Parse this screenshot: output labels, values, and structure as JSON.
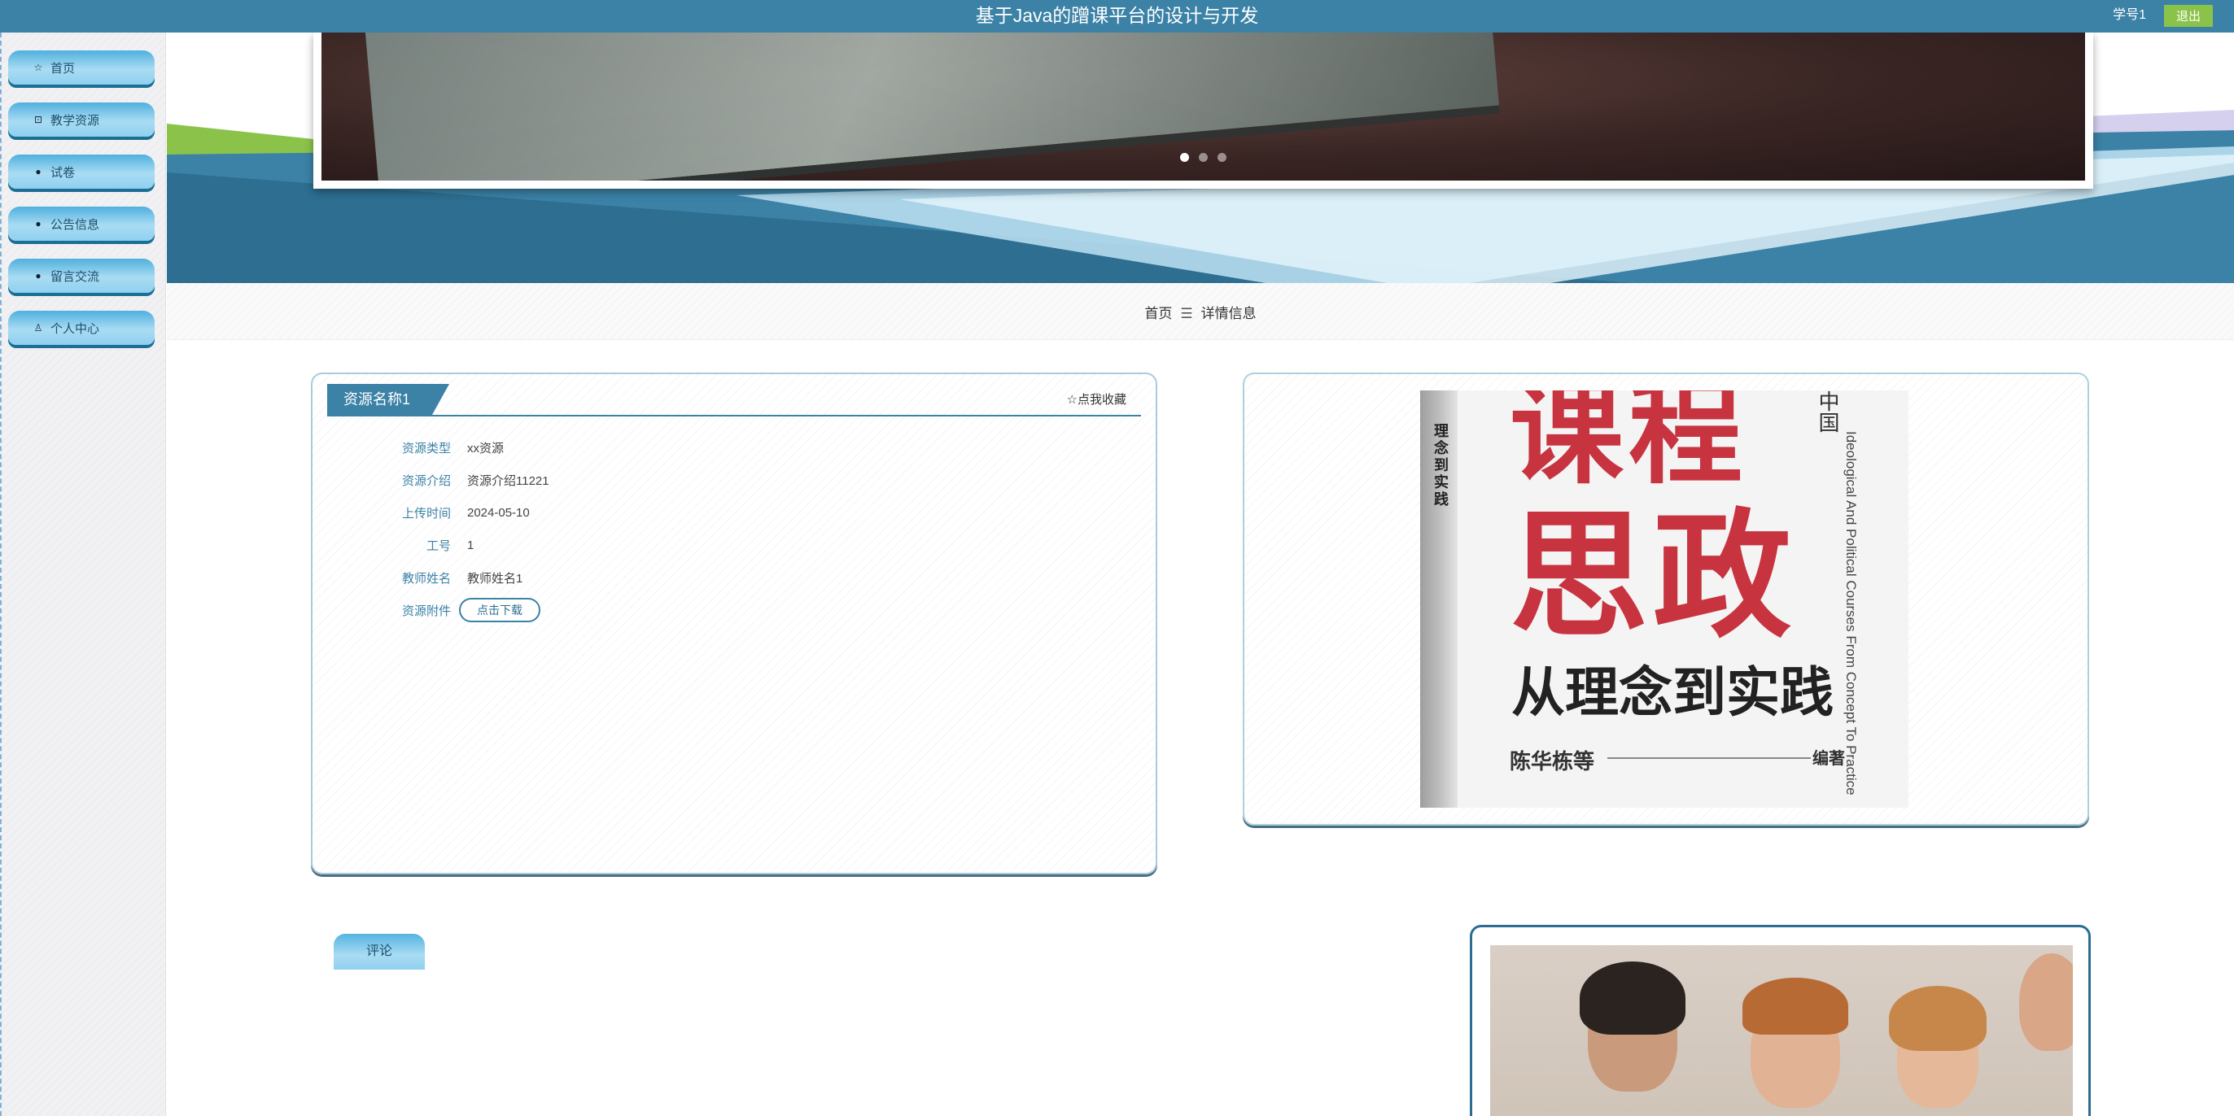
{
  "header": {
    "title": "基于Java的蹭课平台的设计与开发",
    "user": "学号1",
    "logout_label": "退出"
  },
  "sidebar": {
    "items": [
      {
        "label": "首页",
        "icon": "star-icon"
      },
      {
        "label": "教学资源",
        "icon": "bag-icon"
      },
      {
        "label": "试卷",
        "icon": "info-icon"
      },
      {
        "label": "公告信息",
        "icon": "question-icon"
      },
      {
        "label": "留言交流",
        "icon": "info-icon"
      },
      {
        "label": "个人中心",
        "icon": "user-icon"
      }
    ]
  },
  "carousel": {
    "slide_count": 3,
    "active_index": 0
  },
  "breadcrumb": {
    "home": "首页",
    "separator": "☰",
    "current": "详情信息"
  },
  "detail": {
    "name": "资源名称1",
    "favorite_label": "☆点我收藏",
    "fields": [
      {
        "label": "资源类型",
        "value": "xx资源"
      },
      {
        "label": "资源介绍",
        "value": "资源介绍11221"
      },
      {
        "label": "上传时间",
        "value": "2024-05-10"
      },
      {
        "label": "工号",
        "value": "1"
      },
      {
        "label": "教师姓名",
        "value": "教师姓名1"
      },
      {
        "label": "资源附件",
        "value": ""
      }
    ],
    "download_label": "点击下载"
  },
  "cover": {
    "spine_text": "理念到实践",
    "line1": "课程",
    "line2": "思政",
    "subtitle": "从理念到实践",
    "author": "陈华栋等",
    "editor": "编著",
    "english": "Ideological And Political Courses From Concept To Practice",
    "corner": "中国"
  },
  "comment": {
    "tab_label": "评论"
  },
  "colors": {
    "primary": "#3b82a6",
    "accent_green": "#8bc34a",
    "sidebar_button": "#a9dcf3"
  }
}
